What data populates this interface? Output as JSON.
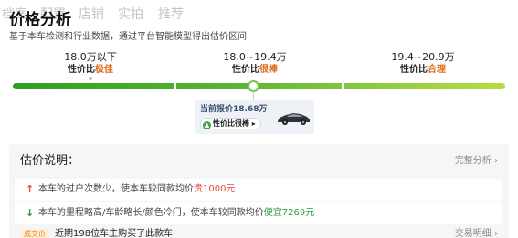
{
  "nav": {
    "tabs": [
      "档案",
      "配置",
      "店铺",
      "实拍",
      "推荐"
    ]
  },
  "header": {
    "title": "价格分析",
    "subtitle": "基于本车检测和行业数据，通过平台智能模型得出估价区间"
  },
  "price_scale": {
    "ranges": [
      {
        "range": "18.0万以下",
        "rating_prefix": "性价比",
        "rating_value": "极佳",
        "color": "#e06b1c"
      },
      {
        "range": "18.0~19.4万",
        "rating_prefix": "性价比",
        "rating_value": "很棒",
        "color": "#e06b1c"
      },
      {
        "range": "19.4~20.9万",
        "rating_prefix": "性价比",
        "rating_value": "合理",
        "color": "#e06b1c"
      }
    ],
    "bar_colors": [
      "#2f9e22",
      "#58b534",
      "#8fcc3e",
      "#b8dd43"
    ],
    "current": {
      "label": "当前报价18.68万",
      "badge": "性价比很棒",
      "badge_icon": "arrow-up-circle-icon",
      "car_icon": "car-icon",
      "position_ratio": 0.485
    }
  },
  "estimate": {
    "title": "估价说明：",
    "more_link": "完整分析",
    "items": [
      {
        "icon": "arrow-up-icon",
        "color": "#e94a3a",
        "text": "本车的过户次数少，使本车较同款均价",
        "highlight": "贵1000元"
      },
      {
        "icon": "arrow-down-icon",
        "color": "#2d9a3d",
        "text": "本车的里程略高/车龄略长/颜色冷门，使本车较同款均价",
        "highlight": "便宜7269元"
      }
    ],
    "deal": {
      "badge": "成交价",
      "text": "近期198位车主购买了此款车",
      "link": "交易明细"
    }
  }
}
